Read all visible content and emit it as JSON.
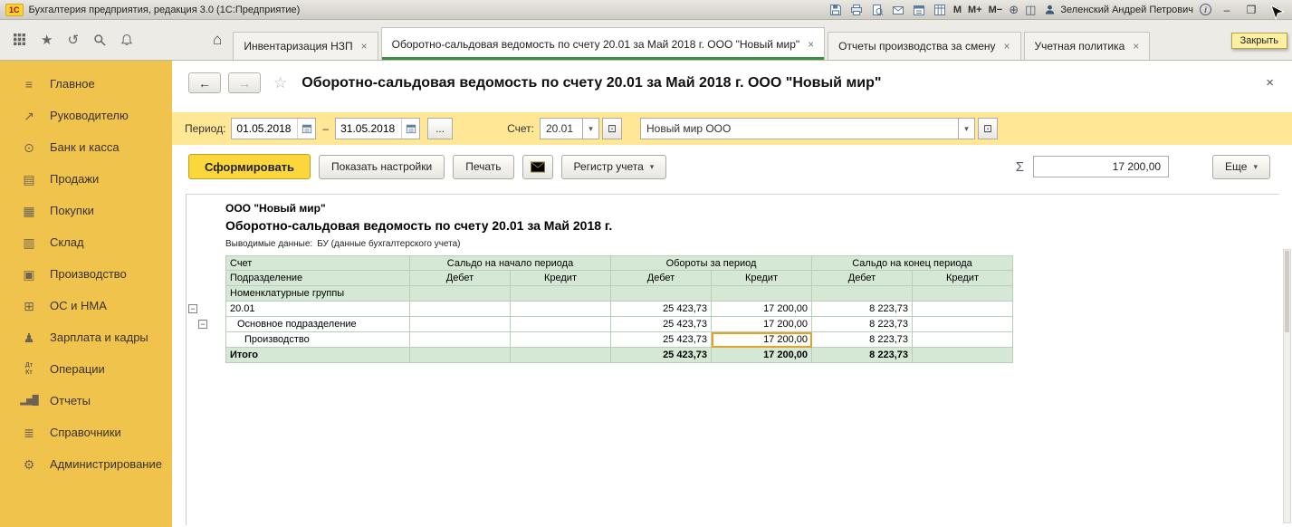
{
  "titlebar": {
    "logo": "1С",
    "app_title": "Бухгалтерия предприятия, редакция 3.0  (1С:Предприятие)",
    "memory_m": "M",
    "memory_mplus": "M+",
    "memory_mminus": "M−",
    "user_name": "Зеленский Андрей Петрович",
    "info": "i",
    "minimize": "–",
    "maximize": "❐",
    "close": "×"
  },
  "tabbar": {
    "tooltip": "Закрыть",
    "tabs": [
      {
        "label": "Инвентаризация НЗП",
        "close": "×"
      },
      {
        "label": "Оборотно-сальдовая ведомость по счету 20.01 за Май 2018 г. ООО \"Новый мир\"",
        "close": "×"
      },
      {
        "label": "Отчеты производства за смену",
        "close": "×"
      },
      {
        "label": "Учетная политика",
        "close": "×"
      }
    ]
  },
  "icons": {
    "star": "★",
    "star_outline": "☆",
    "history": "↺",
    "home": "⌂",
    "chevron_down": "▾",
    "back_arrow": "←",
    "forward_arrow": "→",
    "zoom_plus": "⊕",
    "panel": "◫",
    "open_box": "⊡",
    "expander_minus": "−",
    "ellipsis": "..."
  },
  "sidebar": {
    "items": [
      {
        "label": "Главное",
        "icon": "≡"
      },
      {
        "label": "Руководителю",
        "icon": "↗"
      },
      {
        "label": "Банк и касса",
        "icon": "⊙"
      },
      {
        "label": "Продажи",
        "icon": "▤"
      },
      {
        "label": "Покупки",
        "icon": "▦"
      },
      {
        "label": "Склад",
        "icon": "▥"
      },
      {
        "label": "Производство",
        "icon": "▣"
      },
      {
        "label": "ОС и НМА",
        "icon": "⊞"
      },
      {
        "label": "Зарплата и кадры",
        "icon": "♟"
      },
      {
        "label": "Операции",
        "icon": "Дт\nКт"
      },
      {
        "label": "Отчеты",
        "icon": "▂▅█"
      },
      {
        "label": "Справочники",
        "icon": "≣"
      },
      {
        "label": "Администрирование",
        "icon": "⚙"
      }
    ]
  },
  "page": {
    "title": "Оборотно-сальдовая ведомость по счету 20.01 за Май 2018 г. ООО \"Новый мир\"",
    "close": "×"
  },
  "filters": {
    "period_label": "Период:",
    "period_from": "01.05.2018",
    "period_dash": "–",
    "period_to": "31.05.2018",
    "account_label": "Счет:",
    "account_value": "20.01",
    "organization_value": "Новый мир ООО"
  },
  "actions": {
    "generate": "Сформировать",
    "show_settings": "Показать настройки",
    "print": "Печать",
    "register": "Регистр учета",
    "sum_symbol": "Σ",
    "sum_value": "17 200,00",
    "more": "Еще"
  },
  "report": {
    "company": "ООО \"Новый мир\"",
    "title": "Оборотно-сальдовая ведомость по счету 20.01 за Май 2018 г.",
    "note_label": "Выводимые данные:",
    "note_value": "БУ (данные бухгалтерского учета)",
    "header": {
      "row1_col1": "Счет",
      "row2_col1": "Подразделение",
      "row3_col1": "Номенклатурные группы",
      "group1": "Сальдо на начало периода",
      "group2": "Обороты за период",
      "group3": "Сальдо на конец периода",
      "debit": "Дебет",
      "credit": "Кредит"
    },
    "rows": [
      {
        "name": "20.01",
        "begin_debit": "",
        "begin_credit": "",
        "turn_debit": "25 423,73",
        "turn_credit": "17 200,00",
        "end_debit": "8 223,73",
        "end_credit": ""
      },
      {
        "name": "Основное подразделение",
        "begin_debit": "",
        "begin_credit": "",
        "turn_debit": "25 423,73",
        "turn_credit": "17 200,00",
        "end_debit": "8 223,73",
        "end_credit": ""
      },
      {
        "name": "Производство",
        "begin_debit": "",
        "begin_credit": "",
        "turn_debit": "25 423,73",
        "turn_credit": "17 200,00",
        "end_debit": "8 223,73",
        "end_credit": ""
      },
      {
        "name": "Итого",
        "begin_debit": "",
        "begin_credit": "",
        "turn_debit": "25 423,73",
        "turn_credit": "17 200,00",
        "end_debit": "8 223,73",
        "end_credit": ""
      }
    ]
  }
}
